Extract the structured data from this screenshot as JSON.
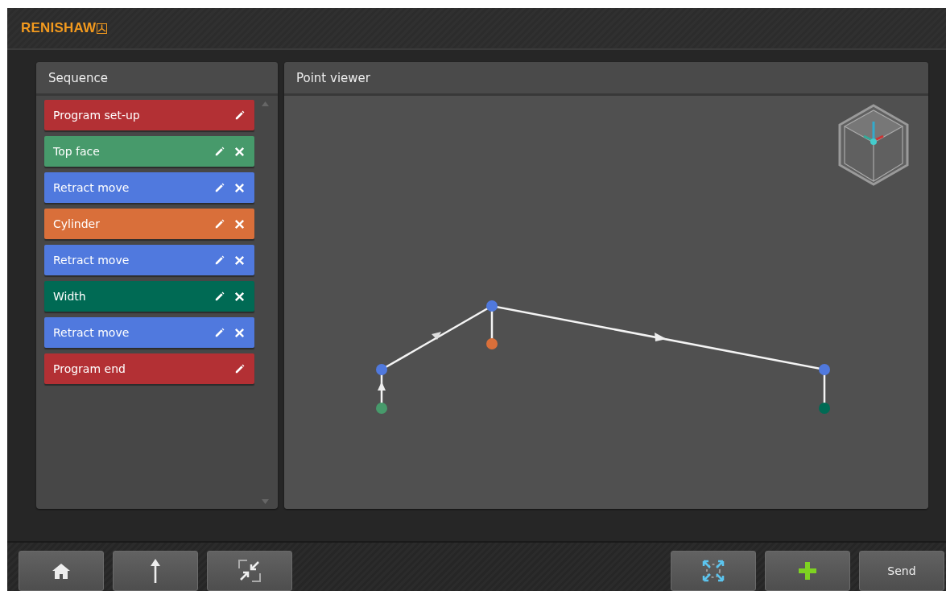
{
  "header": {
    "logo": "RENISHAW"
  },
  "sequence": {
    "title": "Sequence",
    "items": [
      {
        "label": "Program set-up",
        "color": "#b33034",
        "deletable": false
      },
      {
        "label": "Top face",
        "color": "#479a6b",
        "deletable": true
      },
      {
        "label": "Retract move",
        "color": "#5079de",
        "deletable": true
      },
      {
        "label": "Cylinder",
        "color": "#d96f3a",
        "deletable": true
      },
      {
        "label": "Retract move",
        "color": "#5079de",
        "deletable": true
      },
      {
        "label": "Width",
        "color": "#006a54",
        "deletable": true
      },
      {
        "label": "Retract move",
        "color": "#5079de",
        "deletable": true
      },
      {
        "label": "Program end",
        "color": "#b33034",
        "deletable": false
      }
    ]
  },
  "viewer": {
    "title": "Point viewer"
  },
  "toolbar": {
    "send": "Send"
  }
}
